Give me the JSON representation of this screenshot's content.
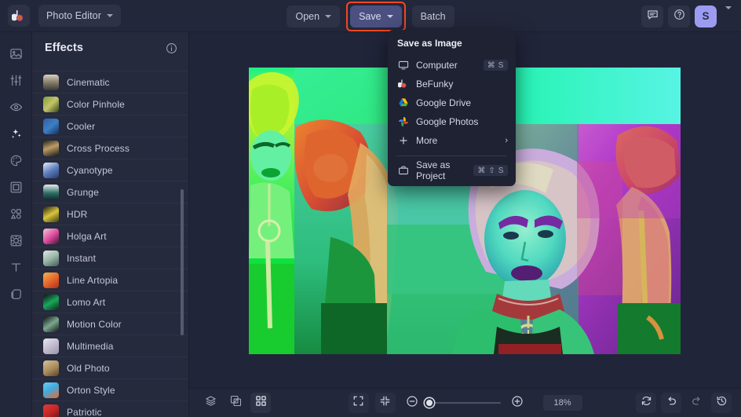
{
  "app": {
    "logo_icon": "befunky-logo-icon",
    "switcher_label": "Photo Editor"
  },
  "toolbar": {
    "open_label": "Open",
    "save_label": "Save",
    "batch_label": "Batch",
    "save_highlight_color": "#f24822",
    "save_button_color": "#4c5080",
    "chat_icon": "chat-icon",
    "help_icon": "help-circle-icon",
    "avatar_initial": "S",
    "avatar_color": "#9b9cf0"
  },
  "save_menu": {
    "title": "Save as Image",
    "items": [
      {
        "label": "Computer",
        "icon": "monitor-icon",
        "shortcut": "⌘ S"
      },
      {
        "label": "BeFunky",
        "icon": "befunky-logo-icon",
        "shortcut": ""
      },
      {
        "label": "Google Drive",
        "icon": "google-drive-icon",
        "shortcut": ""
      },
      {
        "label": "Google Photos",
        "icon": "google-photos-icon",
        "shortcut": ""
      },
      {
        "label": "More",
        "icon": "plus-icon",
        "shortcut": "",
        "submenu": true
      }
    ],
    "project_item": {
      "label": "Save as Project",
      "icon": "briefcase-icon",
      "shortcut": "⌘ ⇧ S"
    }
  },
  "rail": {
    "items": [
      {
        "name": "image-manager",
        "icon": "image-icon",
        "active": false
      },
      {
        "name": "edit-adjust",
        "icon": "sliders-icon",
        "active": false
      },
      {
        "name": "touch-up",
        "icon": "eye-icon",
        "active": false
      },
      {
        "name": "effects",
        "icon": "sparkles-icon",
        "active": true
      },
      {
        "name": "artsy",
        "icon": "palette-icon",
        "active": false
      },
      {
        "name": "frames",
        "icon": "frame-icon",
        "active": false
      },
      {
        "name": "graphics",
        "icon": "shapes-icon",
        "active": false
      },
      {
        "name": "textures",
        "icon": "texture-icon",
        "active": false
      },
      {
        "name": "text",
        "icon": "text-icon",
        "active": false
      },
      {
        "name": "layers",
        "icon": "layers-icon",
        "active": false
      }
    ]
  },
  "panel": {
    "title": "Effects",
    "info_icon": "info-icon",
    "effects": [
      {
        "label": "Cinematic",
        "thumb": "linear-gradient(180deg,#d8d2c2 0%,#8d8471 45%,#3a3a34 100%)"
      },
      {
        "label": "Color Pinhole",
        "thumb": "linear-gradient(135deg,#7ea03a 0%,#c6c36a 50%,#2e4a16 100%)"
      },
      {
        "label": "Cooler",
        "thumb": "linear-gradient(140deg,#2f5ea8 0%,#3d7fc4 50%,#16305e 100%)"
      },
      {
        "label": "Cross Process",
        "thumb": "linear-gradient(160deg,#1c2a12 0%,#c09a6a 45%,#0f1a0c 100%)"
      },
      {
        "label": "Cyanotype",
        "thumb": "linear-gradient(150deg,#e9eef7 0%,#5f7fc0 50%,#223a6e 100%)"
      },
      {
        "label": "Grunge",
        "thumb": "linear-gradient(180deg,#e4eceb 0%,#2d6b63 55%,#0e2b2a 100%)"
      },
      {
        "label": "HDR",
        "thumb": "linear-gradient(150deg,#1d1d12 0%,#d9c63a 50%,#3f3a12 100%)"
      },
      {
        "label": "Holga Art",
        "thumb": "linear-gradient(140deg,#f3c7d8 0%,#d8469a 55%,#3c1730 100%)"
      },
      {
        "label": "Instant",
        "thumb": "linear-gradient(150deg,#e2e8e0 0%,#9ab7a8 50%,#3f5a58 100%)"
      },
      {
        "label": "Line Artopia",
        "thumb": "linear-gradient(145deg,#f3b44a 0%,#e4622a 55%,#a8301a 100%)"
      },
      {
        "label": "Lomo Art",
        "thumb": "linear-gradient(150deg,#0d0d0d 0%,#19a85c 50%,#0a2a16 100%)"
      },
      {
        "label": "Motion Color",
        "thumb": "linear-gradient(145deg,#0e0e0e 0%,#7ba88f 50%,#141414 100%)"
      },
      {
        "label": "Multimedia",
        "thumb": "linear-gradient(145deg,#e9e6ee 0%,#c3bcd0 50%,#9a93ab 100%)"
      },
      {
        "label": "Old Photo",
        "thumb": "linear-gradient(150deg,#d6c29a 0%,#a88a5c 55%,#5a4326 100%)"
      },
      {
        "label": "Orton Style",
        "thumb": "linear-gradient(150deg,#69cdf2 0%,#43a9dd 45%,#e86a2a 100%)"
      },
      {
        "label": "Patriotic",
        "thumb": "linear-gradient(145deg,#e23b3b 0%,#c22626 50%,#6a1212 100%)"
      }
    ]
  },
  "canvas": {
    "photo_alt": "edited-photo-psychedelic-portrait"
  },
  "bottombar": {
    "layers_icon": "layers-stack-icon",
    "compare_icon": "compare-icon",
    "grid_icon": "grid-icon",
    "fullscreen_icon": "expand-icon",
    "fit_icon": "collapse-icon",
    "zoom_out_icon": "zoom-out-icon",
    "zoom_in_icon": "zoom-in-icon",
    "zoom_level": "18%",
    "reset_icon": "reset-icon",
    "undo_icon": "undo-icon",
    "redo_icon": "redo-icon",
    "history_icon": "history-icon"
  }
}
